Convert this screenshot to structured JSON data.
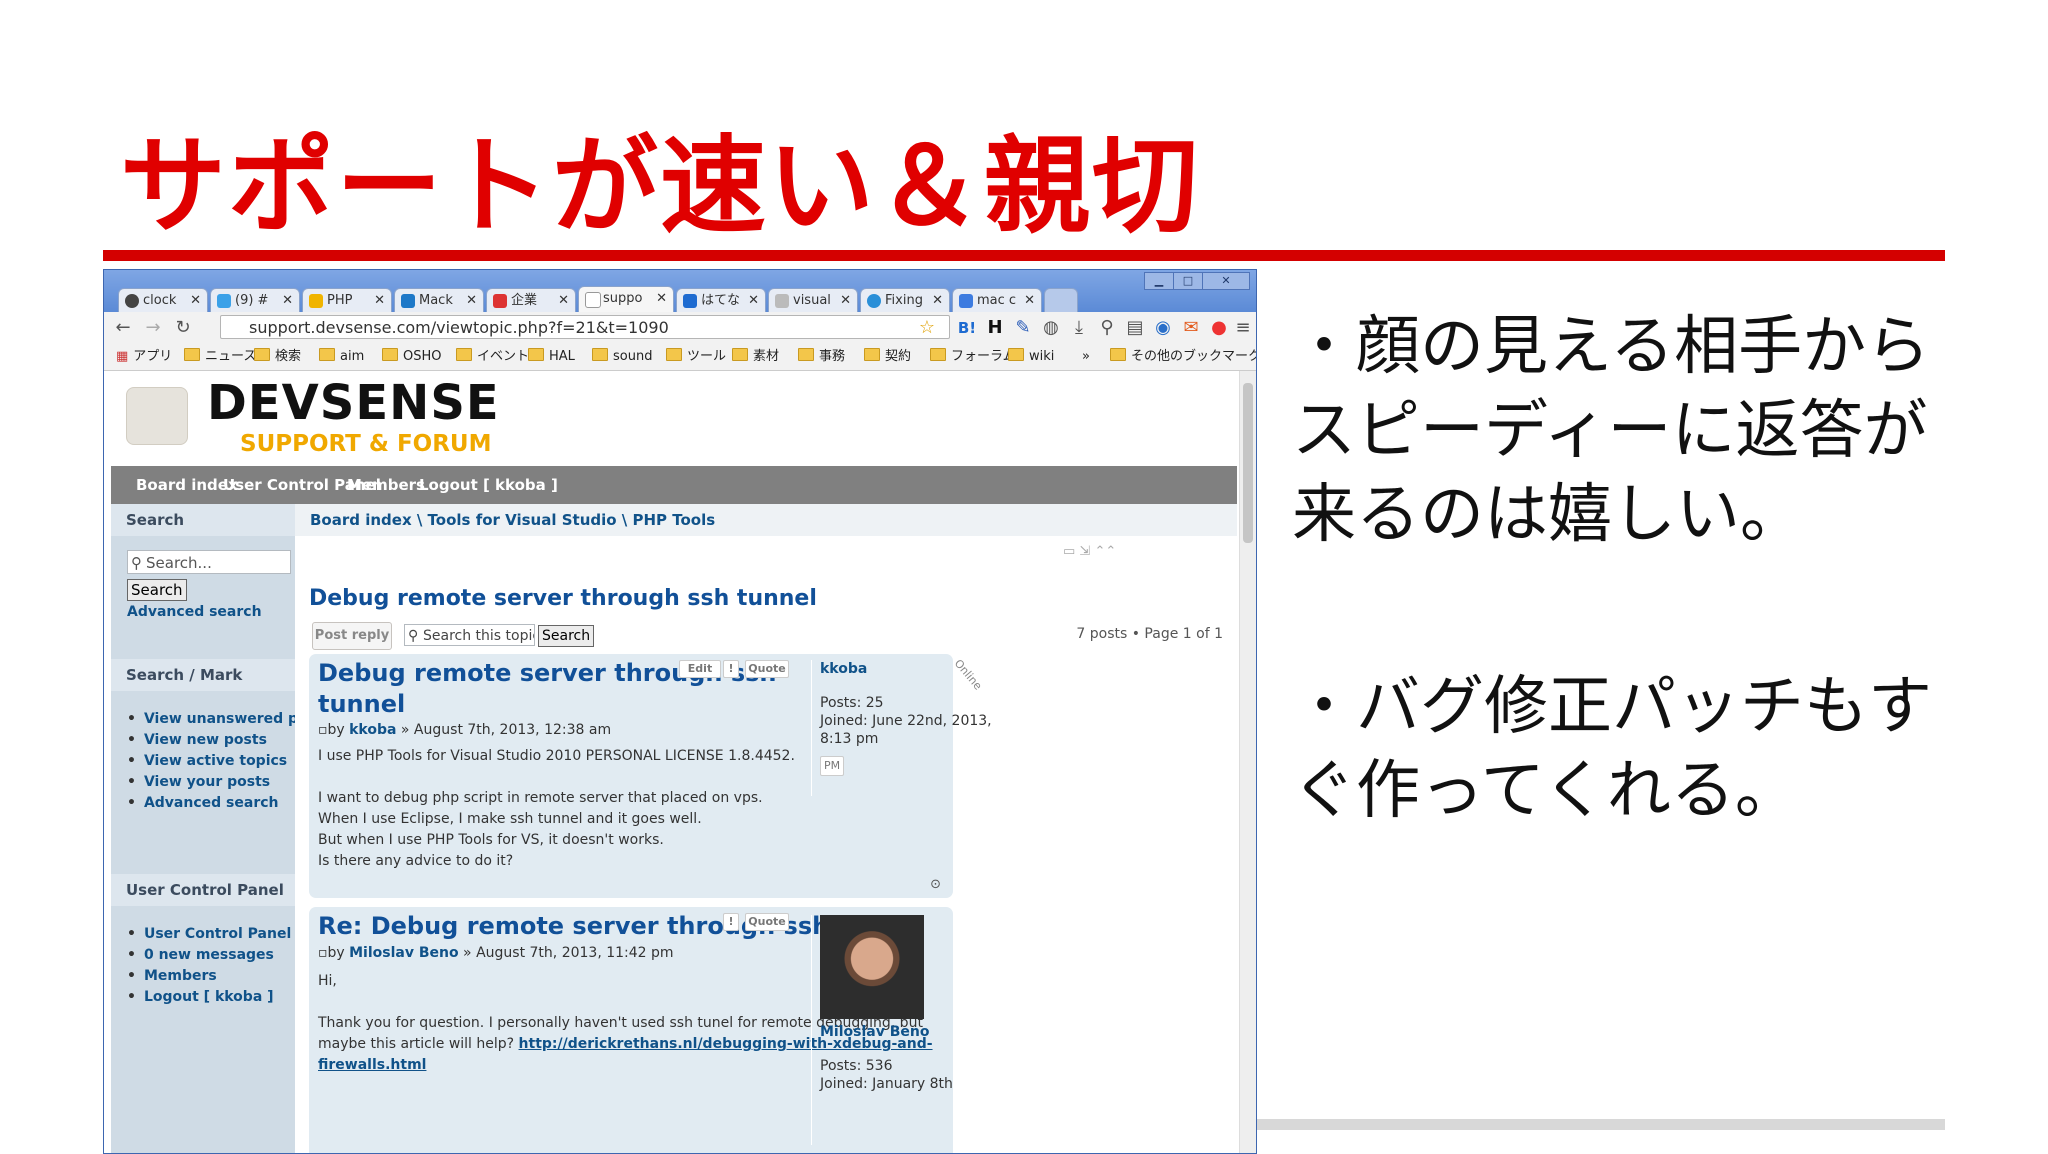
{
  "slide": {
    "title": "サポートが速い＆親切",
    "bullet1_line1": "・顔の見える相手から",
    "bullet1_line2": "スピーディーに返答が",
    "bullet1_line3": "来るのは嬉しい。",
    "bullet2_line1": "・バグ修正パッチもす",
    "bullet2_line2": "ぐ作ってくれる。"
  },
  "browser": {
    "tabs": [
      "clock",
      "(9) #",
      "PHP",
      "Mack",
      "企業",
      "suppo",
      "はてな",
      "visual",
      "Fixing",
      "mac c"
    ],
    "url": "support.devsense.com/viewtopic.php?f=21&t=1090",
    "bookmarks": [
      "アプリ",
      "ニュース",
      "検索",
      "aim",
      "OSHO",
      "イベント",
      "HAL",
      "sound",
      "ツール",
      "素材",
      "事務",
      "契約",
      "フォーラム",
      "wiki",
      "»",
      "その他のブックマーク"
    ]
  },
  "site": {
    "logo_title": "DEVSENSE",
    "logo_sub": "SUPPORT & FORUM",
    "nav": [
      "Board index",
      "User Control Panel",
      "Members",
      "Logout [ kkoba ]"
    ],
    "sidebar": {
      "search_head": "Search",
      "search_placeholder": "Search...",
      "search_button": "Search",
      "advanced_search": "Advanced search",
      "mark_head": "Search / Mark",
      "mark_items": [
        "View unanswered posts",
        "View new posts",
        "View active topics",
        "View your posts",
        "Advanced search"
      ],
      "ucp_head": "User Control Panel",
      "ucp_items": [
        "User Control Panel",
        "0 new messages",
        "Members",
        "Logout [ kkoba ]"
      ]
    },
    "breadcrumb": "Board index  \\  Tools for Visual Studio  \\  PHP Tools",
    "topic_title": "Debug remote server through ssh tunnel",
    "post_reply": "Post reply",
    "topic_search_placeholder": "Search this topic...",
    "topic_search_button": "Search",
    "pagination": "7 posts • Page 1 of 1",
    "post1": {
      "title_line1": "Debug remote server through ssh",
      "title_line2": "tunnel",
      "by": "by",
      "author": "kkoba",
      "date": " » August 7th, 2013, 12:38 am",
      "btn_edit": "Edit",
      "btn_report": "!",
      "btn_quote": "Quote",
      "body1": "I use PHP Tools for Visual Studio 2010 PERSONAL LICENSE 1.8.4452.",
      "body2": "I want to debug php script in remote server that placed on vps.",
      "body3": "When I use Eclipse, I make ssh tunnel and it goes well.",
      "body4": "But when I use PHP Tools for VS, it doesn't works.",
      "body5": "Is there any advice to do it?",
      "profile_name": "kkoba",
      "online": "Online",
      "posts": "Posts: 25",
      "joined1": "Joined: June 22nd, 2013,",
      "joined2": "8:13 pm",
      "pm": "PM"
    },
    "post2": {
      "title": "Re: Debug remote server through ssh tunnel",
      "by": "by",
      "author": "Miloslav Beno",
      "date": " » August 7th, 2013, 11:42 pm",
      "btn_report": "!",
      "btn_quote": "Quote",
      "body1": "Hi,",
      "body2": "Thank you for question. I personally haven't used ssh tunel for remote debugging, but",
      "body3_prefix": "maybe this article will help? ",
      "link1": "http://derickrethans.nl/debugging-with-xdebug-and-",
      "link2": "firewalls.html",
      "profile_name": "Miloslav Beno",
      "posts": "Posts: 536",
      "joined": "Joined: January 8th"
    }
  },
  "colors": {
    "title_red": "#e00000",
    "rule_red": "#d40000",
    "link_blue": "#105289"
  }
}
